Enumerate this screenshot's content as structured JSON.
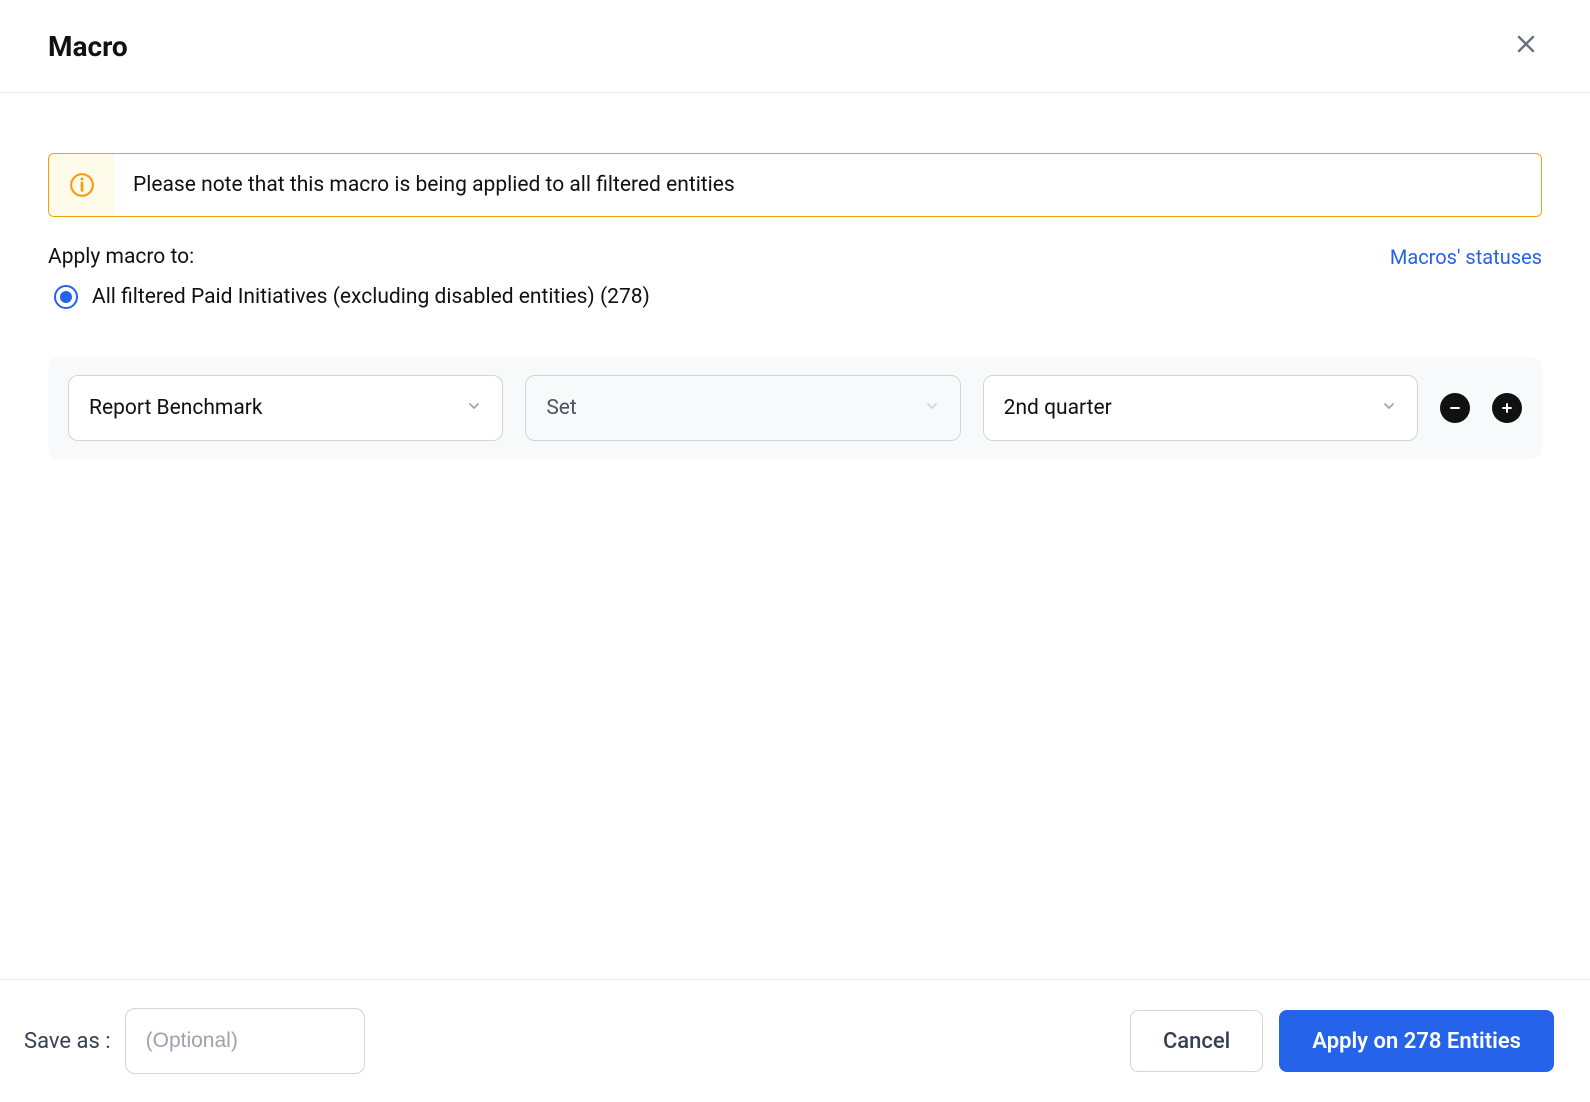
{
  "header": {
    "title": "Macro"
  },
  "alert": {
    "text": "Please note that this macro is being applied to all filtered entities"
  },
  "apply": {
    "label": "Apply macro to:",
    "statuses_link": "Macros' statuses",
    "radio_label": "All filtered Paid Initiatives (excluding disabled entities) (278)"
  },
  "rule": {
    "field": "Report Benchmark",
    "action": "Set",
    "value": "2nd quarter"
  },
  "footer": {
    "save_label": "Save as :",
    "save_placeholder": "(Optional)",
    "cancel_label": "Cancel",
    "apply_label": "Apply on 278 Entities"
  }
}
